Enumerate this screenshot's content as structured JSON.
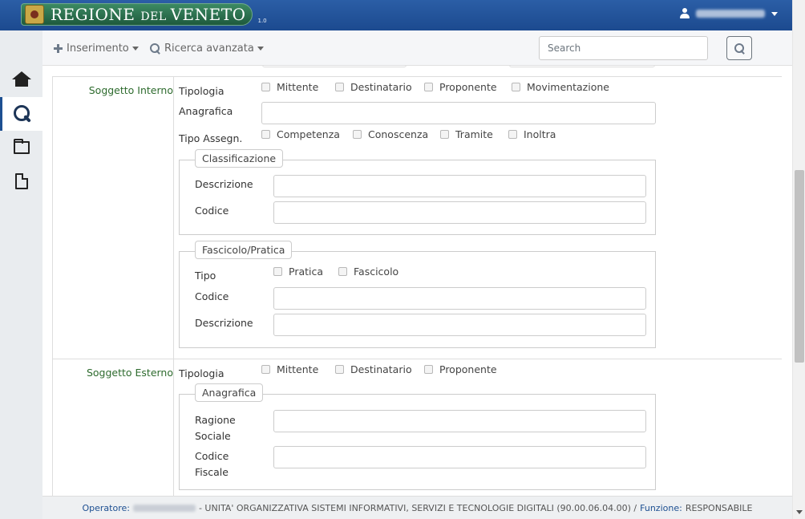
{
  "header": {
    "logo_main": "REGIONE ",
    "logo_small": "DEL ",
    "logo_end": "VENETO",
    "version": "1.0"
  },
  "nav": {
    "insert_label": "Inserimento",
    "advanced_search_label": "Ricerca avanzata",
    "search_placeholder": "Search"
  },
  "soggetto_interno": {
    "label": "Soggetto Interno",
    "tipologia_label": "Tipologia",
    "tipologia_options": [
      "Mittente",
      "Destinatario",
      "Proponente",
      "Movimentazione"
    ],
    "anagrafica_label": "Anagrafica",
    "tipo_assegn_label": "Tipo Assegn.",
    "tipo_assegn_options": [
      "Competenza",
      "Conoscenza",
      "Tramite",
      "Inoltra"
    ],
    "classificazione": {
      "legend": "Classificazione",
      "descrizione_label": "Descrizione",
      "codice_label": "Codice"
    },
    "fascicolo": {
      "legend": "Fascicolo/Pratica",
      "tipo_label": "Tipo",
      "tipo_options": [
        "Pratica",
        "Fascicolo"
      ],
      "codice_label": "Codice",
      "descrizione_label": "Descrizione"
    }
  },
  "soggetto_esterno": {
    "label": "Soggetto Esterno",
    "tipologia_label": "Tipologia",
    "tipologia_options": [
      "Mittente",
      "Destinatario",
      "Proponente"
    ],
    "anagrafica": {
      "legend": "Anagrafica",
      "ragione_label_1": "Ragione",
      "ragione_label_2": "Sociale",
      "codice_label_1": "Codice",
      "codice_label_2": "Fiscale"
    }
  },
  "footer": {
    "operatore_key": "Operatore:",
    "unit_text": "- UNITA' ORGANIZZATIVA SISTEMI INFORMATIVI, SERVIZI E TECNOLOGIE DIGITALI (90.00.06.04.00)  /",
    "funzione_key": "Funzione:",
    "funzione_value": "RESPONSABILE"
  }
}
